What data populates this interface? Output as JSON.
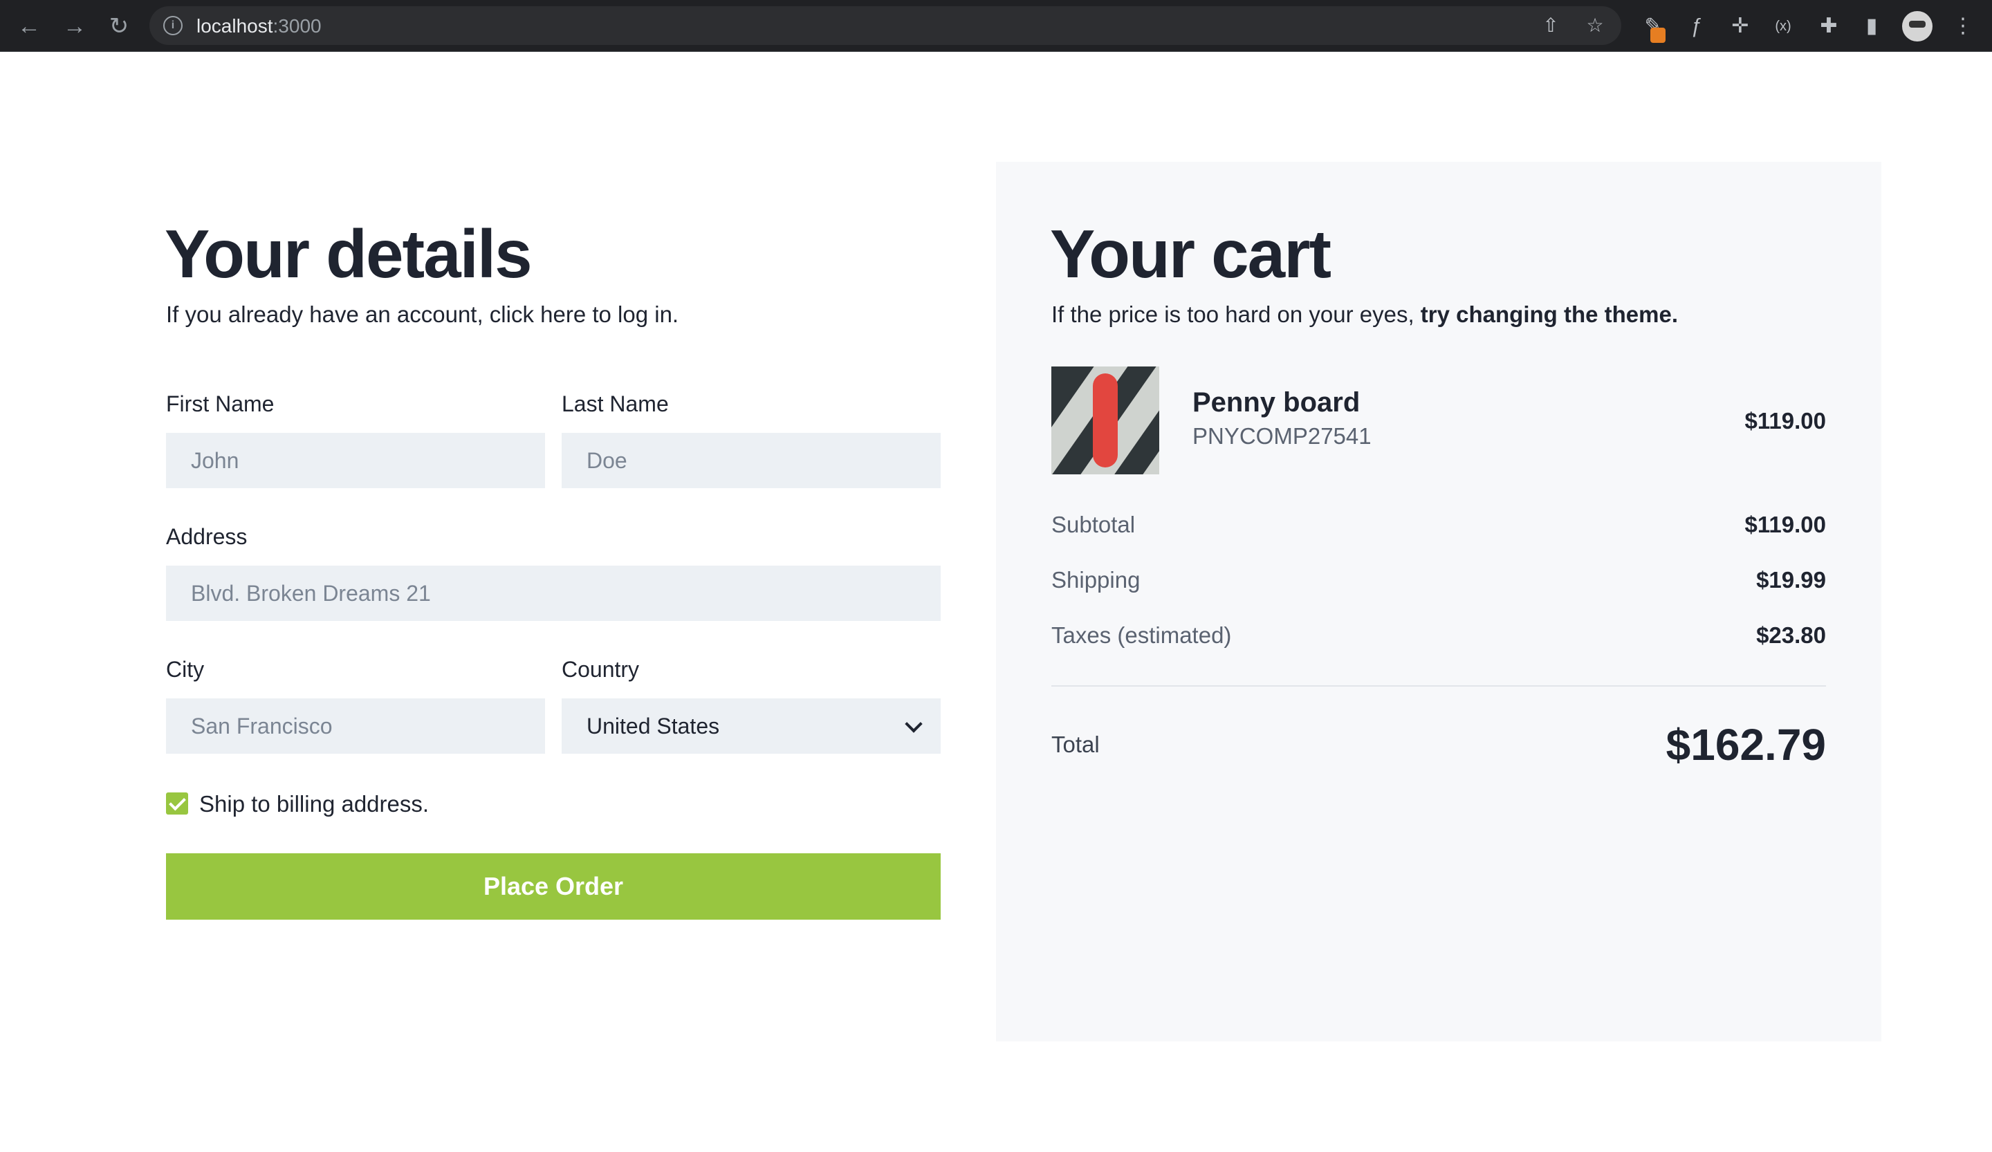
{
  "browser": {
    "url_host": "localhost",
    "url_port": ":3000"
  },
  "details": {
    "title": "Your details",
    "subtitle": "If you already have an account, click here to log in.",
    "first_name": {
      "label": "First Name",
      "placeholder": "John"
    },
    "last_name": {
      "label": "Last Name",
      "placeholder": "Doe"
    },
    "address": {
      "label": "Address",
      "placeholder": "Blvd. Broken Dreams 21"
    },
    "city": {
      "label": "City",
      "placeholder": "San Francisco"
    },
    "country": {
      "label": "Country",
      "value": "United States"
    },
    "ship_billing": {
      "label": "Ship to billing address.",
      "checked": true
    },
    "place_order": "Place Order",
    "accent_color": "#98c640"
  },
  "cart": {
    "title": "Your cart",
    "subtitle_plain": "If the price is too hard on your eyes, ",
    "subtitle_bold": "try changing the theme.",
    "item": {
      "name": "Penny board",
      "sku": "PNYCOMP27541",
      "price": "$119.00"
    },
    "subtotal": {
      "label": "Subtotal",
      "value": "$119.00"
    },
    "shipping": {
      "label": "Shipping",
      "value": "$19.99"
    },
    "taxes": {
      "label": "Taxes (estimated)",
      "value": "$23.80"
    },
    "total": {
      "label": "Total",
      "value": "$162.79"
    }
  }
}
